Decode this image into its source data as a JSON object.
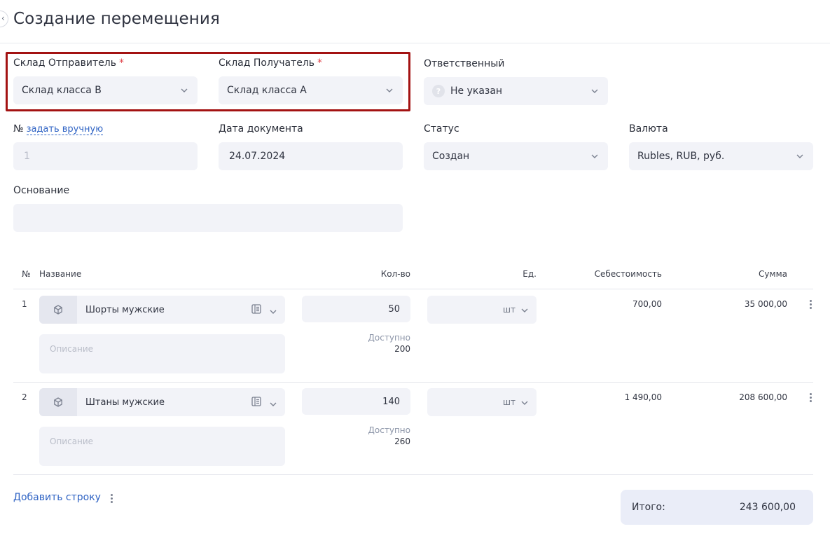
{
  "page": {
    "title": "Создание перемещения"
  },
  "form": {
    "sender": {
      "label": "Склад Отправитель",
      "required": "*",
      "value": "Склад класса В"
    },
    "receiver": {
      "label": "Склад Получатель",
      "required": "*",
      "value": "Склад класса А"
    },
    "responsible": {
      "label": "Ответственный",
      "value": "Не указан",
      "icon_text": "?"
    },
    "number": {
      "label": "№",
      "link": "задать вручную",
      "placeholder": "1"
    },
    "doc_date": {
      "label": "Дата документа",
      "value": "24.07.2024"
    },
    "status": {
      "label": "Статус",
      "value": "Создан"
    },
    "currency": {
      "label": "Валюта",
      "value": "Rubles, RUB, руб."
    },
    "basis": {
      "label": "Основание",
      "value": ""
    }
  },
  "table": {
    "headers": {
      "num": "№",
      "name": "Название",
      "qty": "Кол-во",
      "unit": "Ед.",
      "cost": "Себестоимость",
      "sum": "Сумма"
    },
    "rows": [
      {
        "num": "1",
        "name": "Шорты мужские",
        "desc_placeholder": "Описание",
        "qty": "50",
        "avail_label": "Доступно",
        "avail": "200",
        "unit": "шт",
        "cost": "700,00",
        "sum": "35 000,00"
      },
      {
        "num": "2",
        "name": "Штаны мужские",
        "desc_placeholder": "Описание",
        "qty": "140",
        "avail_label": "Доступно",
        "avail": "260",
        "unit": "шт",
        "cost": "1 490,00",
        "sum": "208 600,00"
      }
    ]
  },
  "footer": {
    "add_row": "Добавить строку",
    "total_label": "Итого:",
    "total_value": "243 600,00"
  },
  "colors": {
    "accent": "#2f63c4",
    "highlight": "#a31212",
    "field_bg": "#f2f3f8",
    "required": "#e0444a"
  }
}
